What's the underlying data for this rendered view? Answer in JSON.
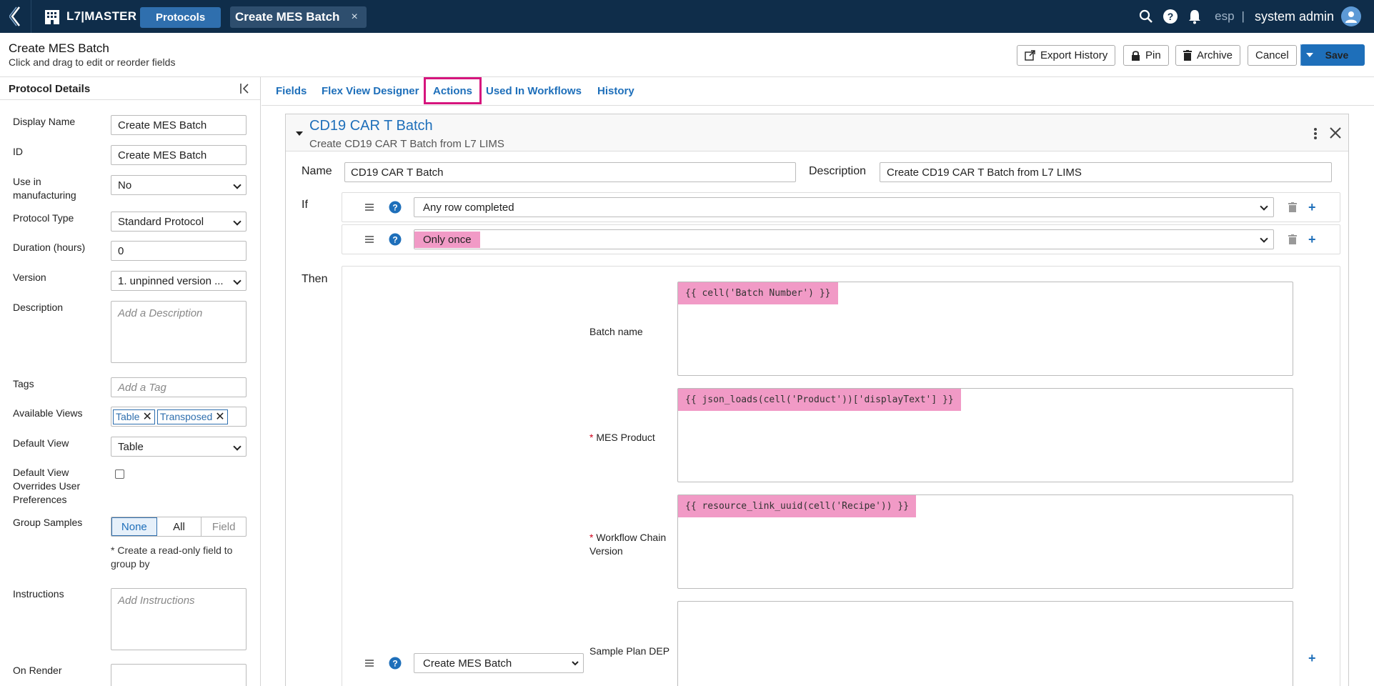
{
  "topbar": {
    "brand": "L7|MASTER",
    "protocols_label": "Protocols",
    "doc_tab": "Create MES Batch",
    "doc_tab_close": "×",
    "tenant": "esp",
    "separator": "|",
    "user": "system admin"
  },
  "header": {
    "title": "Create MES Batch",
    "subtitle": "Click and drag to edit or reorder fields",
    "export_history": "Export History",
    "pin": "Pin",
    "archive": "Archive",
    "cancel": "Cancel",
    "save": "Save"
  },
  "sidebar": {
    "title": "Protocol Details",
    "display_name_label": "Display Name",
    "display_name": "Create MES Batch",
    "id_label": "ID",
    "id": "Create MES Batch",
    "use_mfg_label": "Use in manufacturing",
    "use_mfg": "No",
    "protocol_type_label": "Protocol Type",
    "protocol_type": "Standard Protocol",
    "duration_label": "Duration (hours)",
    "duration": "0",
    "version_label": "Version",
    "version": "1. unpinned version ...",
    "description_label": "Description",
    "description_placeholder": "Add a Description",
    "tags_label": "Tags",
    "tags_placeholder": "Add a Tag",
    "available_views_label": "Available Views",
    "views": [
      "Table",
      "Transposed"
    ],
    "default_view_label": "Default View",
    "default_view": "Table",
    "override_label": "Default View Overrides User Preferences",
    "group_samples_label": "Group Samples",
    "group_options": [
      "None",
      "All",
      "Field"
    ],
    "group_note": "* Create a read-only field to group by",
    "instructions_label": "Instructions",
    "instructions_placeholder": "Add Instructions",
    "on_render_label": "On Render"
  },
  "tabs": [
    "Fields",
    "Flex View Designer",
    "Actions",
    "Used In Workflows",
    "History"
  ],
  "action": {
    "title": "CD19 CAR T Batch",
    "subtitle": "Create CD19 CAR T Batch from L7 LIMS",
    "name_label": "Name",
    "name": "CD19 CAR T Batch",
    "description_label": "Description",
    "description": "Create CD19 CAR T Batch from L7 LIMS",
    "if_label": "If",
    "condition_1": "Any row completed",
    "condition_2": "Only once",
    "then_label": "Then",
    "then_action": "Create MES Batch",
    "params": [
      {
        "label": "Batch name",
        "required": "",
        "value": "{{ cell('Batch Number') }}"
      },
      {
        "label": "MES Product",
        "required": "*",
        "value": "{{ json_loads(cell('Product'))['displayText'] }}"
      },
      {
        "label": "Workflow Chain Version",
        "required": "*",
        "value": "{{ resource_link_uuid(cell('Recipe')) }}"
      },
      {
        "label": "Sample Plan DEP",
        "required": "",
        "value": ""
      }
    ]
  },
  "colors": {
    "topbar": "#0f2d4a",
    "accent": "#1e6fba",
    "highlight": "#f19ac6",
    "active_tab_border": "#d6157d"
  },
  "icons": [
    "back-chevron-icon",
    "building-icon",
    "search-icon",
    "help-icon",
    "bell-icon",
    "user-icon",
    "export-icon",
    "lock-icon",
    "trash-icon",
    "collapse-icon",
    "drag-icon",
    "kebab-icon",
    "close-icon",
    "plus-icon"
  ]
}
